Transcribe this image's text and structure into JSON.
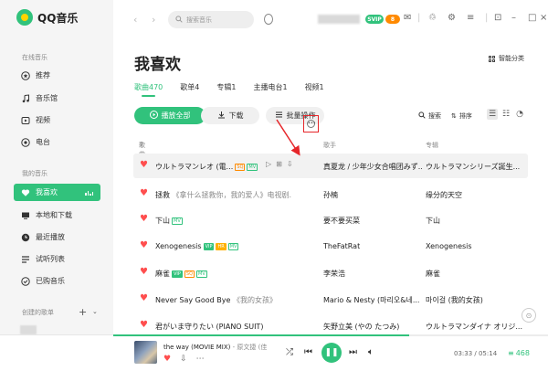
{
  "app": {
    "name": "QQ音乐"
  },
  "sidebar": {
    "section_online": "在线音乐",
    "online_items": [
      {
        "label": "推荐",
        "icon": "star-icon"
      },
      {
        "label": "音乐馆",
        "icon": "music-note-icon"
      },
      {
        "label": "视频",
        "icon": "video-icon"
      },
      {
        "label": "电台",
        "icon": "radio-icon"
      }
    ],
    "section_mine": "我的音乐",
    "mine_items": [
      {
        "label": "我喜欢",
        "icon": "heart-icon",
        "active": true
      },
      {
        "label": "本地和下载",
        "icon": "computer-icon"
      },
      {
        "label": "最近播放",
        "icon": "clock-icon"
      },
      {
        "label": "试听列表",
        "icon": "list-icon"
      },
      {
        "label": "已购音乐",
        "icon": "purchased-icon"
      }
    ],
    "section_created": "创建的歌单"
  },
  "topbar": {
    "search_placeholder": "搜索音乐",
    "badge_green": "SVIP",
    "badge_orange": "8"
  },
  "main": {
    "title": "我喜欢",
    "smart_category": "智能分类",
    "tabs": [
      {
        "label": "歌曲470",
        "active": true
      },
      {
        "label": "歌单4"
      },
      {
        "label": "专辑1"
      },
      {
        "label": "主播电台1"
      },
      {
        "label": "视频1"
      }
    ],
    "play_all": "播放全部",
    "download": "下载",
    "batch": "批量操作",
    "search": "搜索",
    "sort": "排序",
    "columns": {
      "song": "歌曲",
      "singer": "歌手",
      "album": "专辑"
    },
    "songs": [
      {
        "title": "ウルトラマンレオ (電...",
        "sub": "",
        "singer": "真夏龙 / 少年少女合唱团みず...",
        "album": "ウルトラマンシリーズ誕生..."
      },
      {
        "title": "拯救",
        "sub": "《拿什么拯救你，我的爱人》电视剧...",
        "singer": "孙楠",
        "album": "缘分的天空"
      },
      {
        "title": "下山",
        "sub": "",
        "singer": "要不要买菜",
        "album": "下山"
      },
      {
        "title": "Xenogenesis",
        "sub": "",
        "singer": "TheFatRat",
        "album": "Xenogenesis"
      },
      {
        "title": "麻雀",
        "sub": "",
        "singer": "李荣浩",
        "album": "麻雀"
      },
      {
        "title": "Never Say Good Bye",
        "sub": "《我的女孩》",
        "singer": "Mario & Nesty (마리오&네...",
        "album": "마이걸 (我的女孩)"
      },
      {
        "title": "君がいま守りたい (PIANO SUIT)",
        "sub": "",
        "singer": "矢野立美 (やの たつみ)",
        "album": "ウルトラマンダイナ オリジ..."
      }
    ]
  },
  "player": {
    "title": "the way (MOVIE MIX)",
    "artist": "- 原文捷 (佳",
    "time": "03:33 / 05:14",
    "queue_count": "468",
    "progress": 0.68
  }
}
